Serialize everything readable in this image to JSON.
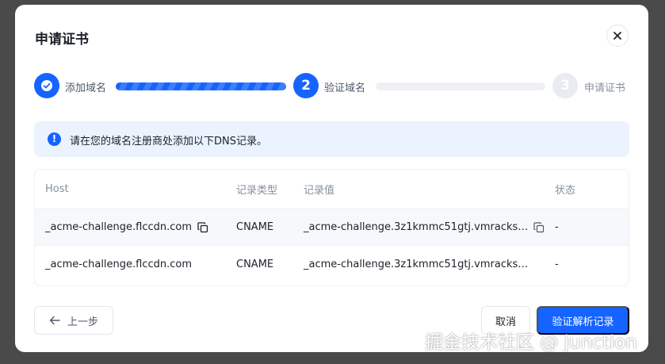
{
  "dialog": {
    "title": "申请证书",
    "steps": [
      {
        "label": "添加域名",
        "number": "1",
        "state": "done"
      },
      {
        "label": "验证域名",
        "number": "2",
        "state": "active"
      },
      {
        "label": "申请证书",
        "number": "3",
        "state": "todo"
      }
    ],
    "alert": {
      "icon": "info-icon",
      "text": "请在您的域名注册商处添加以下DNS记录。"
    },
    "table": {
      "columns": [
        "Host",
        "记录类型",
        "记录值",
        "状态"
      ],
      "rows": [
        {
          "host": "_acme-challenge.flccdn.com",
          "type": "CNAME",
          "value": "_acme-challenge.3z1kmmc51gtj.vmracks…",
          "status": "-"
        },
        {
          "host": "_acme-challenge.flccdn.com",
          "type": "CNAME",
          "value": "_acme-challenge.3z1kmmc51gtj.vmracks…",
          "status": "-"
        }
      ]
    },
    "footer": {
      "prev_label": "上一步",
      "cancel_label": "取消",
      "verify_label": "验证解析记录"
    }
  },
  "watermark": "掘金技术社区 @ junction",
  "colors": {
    "primary": "#1664ff",
    "alert_bg": "#eaf3fe",
    "overlay": "#4a4a4a"
  }
}
